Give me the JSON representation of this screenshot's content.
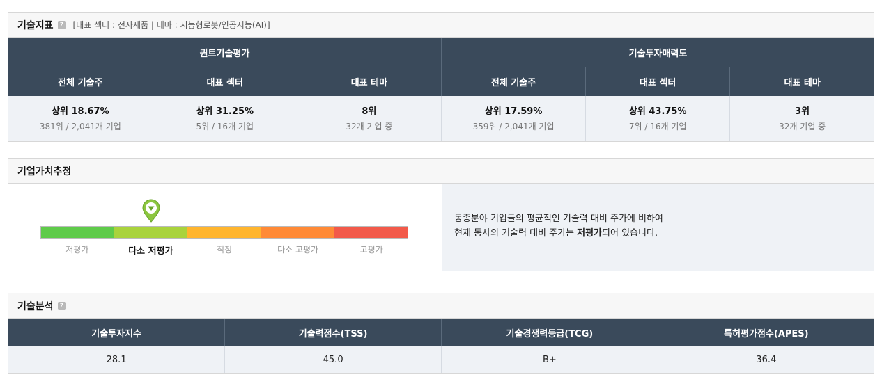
{
  "tech_index": {
    "title": "기술지표",
    "subtitle": "[대표 섹터 : 전자제품 | 테마 : 지능형로봇/인공지능(AI)]",
    "group1": "퀀트기술평가",
    "group2": "기술투자매력도",
    "columns": [
      "전체 기술주",
      "대표 섹터",
      "대표 테마",
      "전체 기술주",
      "대표 섹터",
      "대표 테마"
    ],
    "cells": [
      {
        "main": "상위 18.67%",
        "sub": "381위 / 2,041개 기업"
      },
      {
        "main": "상위 31.25%",
        "sub": "5위 / 16개 기업"
      },
      {
        "main": "8위",
        "sub": "32개 기업 중"
      },
      {
        "main": "상위 17.59%",
        "sub": "359위 / 2,041개 기업"
      },
      {
        "main": "상위 43.75%",
        "sub": "7위 / 16개 기업"
      },
      {
        "main": "3위",
        "sub": "32개 기업 중"
      }
    ]
  },
  "valuation": {
    "title": "기업가치추정",
    "labels": [
      "저평가",
      "다소 저평가",
      "적정",
      "다소 고평가",
      "고평가"
    ],
    "active_index": 1,
    "colors": [
      "#5fcb4a",
      "#a9d33c",
      "#ffb52e",
      "#ff8a36",
      "#f25a4a"
    ],
    "desc_line1": "동종분야 기업들의 평균적인 기술력 대비 주가에 비하여",
    "desc_line2_pre": "현재 동사의 기술력 대비 주가는 ",
    "desc_line2_bold": "저평가",
    "desc_line2_post": "되어 있습니다."
  },
  "analysis": {
    "title": "기술분석",
    "columns": [
      "기술투자지수",
      "기술력점수(TSS)",
      "기술경쟁력등급(TCG)",
      "특허평가점수(APES)"
    ],
    "values": [
      "28.1",
      "45.0",
      "B+",
      "36.4"
    ]
  }
}
